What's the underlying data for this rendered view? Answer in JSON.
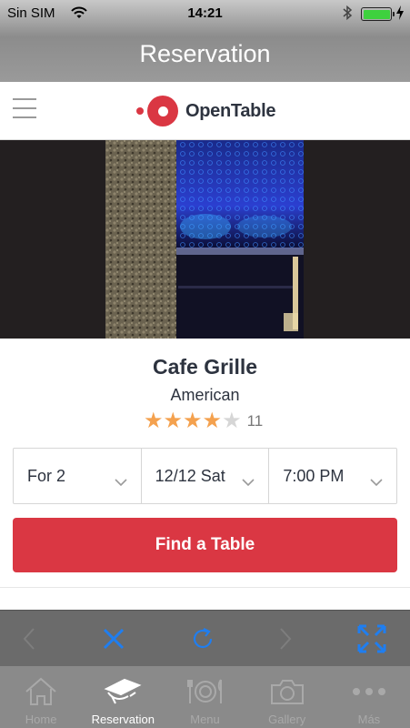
{
  "status_bar": {
    "carrier": "Sin SIM",
    "time": "14:21"
  },
  "nav": {
    "title": "Reservation"
  },
  "site": {
    "brand": "OpenTable",
    "brand_color": "#da3743"
  },
  "restaurant": {
    "name": "Cafe Grille",
    "cuisine": "American",
    "rating": 4,
    "rating_max": 5,
    "review_count": "11"
  },
  "booking": {
    "party_size": "For 2",
    "date": "12/12 Sat",
    "time": "7:00 PM",
    "find_label": "Find a Table"
  },
  "browser_toolbar": {
    "icons": [
      "back-arrow-icon",
      "close-x-icon",
      "reload-icon",
      "forward-arrow-icon",
      "fullscreen-icon"
    ],
    "active_color": "#1f7ef0"
  },
  "tabs": [
    {
      "label": "Home",
      "icon": "home-icon"
    },
    {
      "label": "Reservation",
      "icon": "reservation-icon",
      "active": true
    },
    {
      "label": "Menu",
      "icon": "menu-plate-icon"
    },
    {
      "label": "Gallery",
      "icon": "camera-icon"
    },
    {
      "label": "Más",
      "icon": "more-dots-icon"
    }
  ]
}
